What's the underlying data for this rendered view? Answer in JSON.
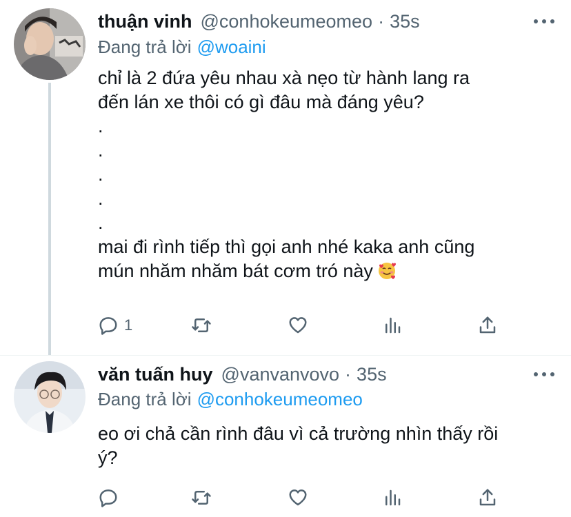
{
  "tweets": [
    {
      "name": "thuận vinh",
      "handle": "@conhokeumeomeo",
      "dot": "·",
      "time": "35s",
      "replying_prefix": "Đang trả lời",
      "replying_to": "@woaini",
      "lines": [
        "chỉ là 2 đứa yêu nhau xà nẹo từ hành lang ra",
        "đến lán xe thôi có gì đâu mà đáng yêu?",
        ".",
        ".",
        ".",
        ".",
        ".",
        "mai đi rình tiếp thì gọi anh nhé kaka anh cũng",
        "mún nhăm nhăm bát cơm tró này"
      ],
      "emoji": "smiling-face-with-hearts",
      "reply_count": "1"
    },
    {
      "name": "văn tuấn huy",
      "handle": "@vanvanvovo",
      "dot": "·",
      "time": "35s",
      "replying_prefix": "Đang trả lời",
      "replying_to": "@conhokeumeomeo",
      "lines": [
        "eo ơi chả cần rình đâu vì cả trường nhìn thấy rồi",
        "ý?"
      ],
      "reply_count": ""
    }
  ],
  "colors": {
    "text": "#0f1419",
    "secondary": "#536471",
    "link": "#1d9bf0",
    "thread_line": "#cfd9de"
  },
  "icons": [
    "reply-icon",
    "retweet-icon",
    "like-icon",
    "analytics-icon",
    "share-icon",
    "more-icon"
  ]
}
